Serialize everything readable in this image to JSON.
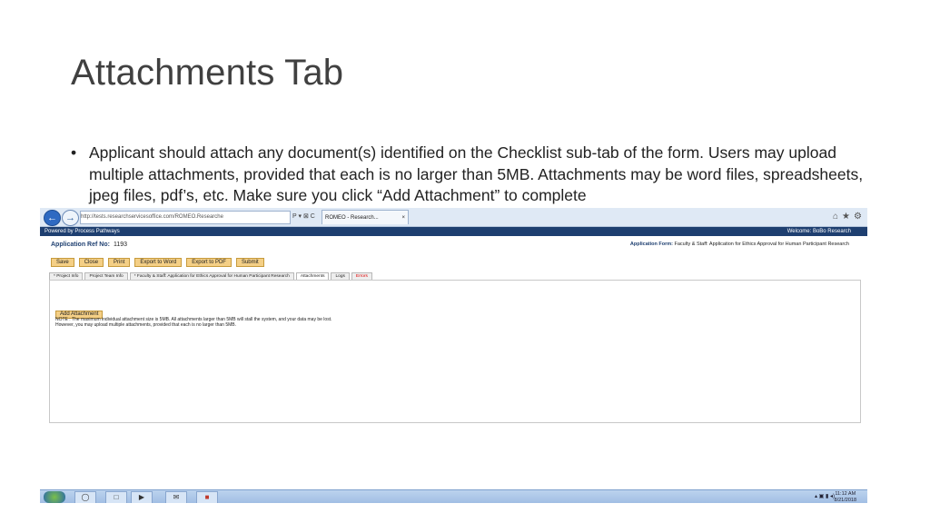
{
  "slide": {
    "title": "Attachments Tab",
    "bullet_marker": "•",
    "bullet_text": "Applicant should attach any document(s) identified on the Checklist sub-tab of the form. Users may upload multiple attachments, provided that each is no larger than 5MB. Attachments may be word files, spreadsheets, jpeg files, pdf’s, etc. Make sure you click “Add Attachment” to complete"
  },
  "browser": {
    "address": "http://tests.researchservicesoffice.com/ROMEO.Researche",
    "address_controls": "P ▾ ⊠ C",
    "tab_label": "ROMEO - Research...",
    "tab_close": "×",
    "icons": [
      "back-icon",
      "forward-icon",
      "home-icon",
      "star-icon",
      "gear-icon"
    ]
  },
  "app": {
    "powered_by": "Powered by Process Pathways",
    "welcome": "Welcome: BoBo Research",
    "ref_label": "Application Ref No:",
    "ref_number": "1193",
    "form_label": "Application Form:",
    "form_name": "Faculty & Staff: Application for Ethics Approval for Human Participant Research",
    "toolbar": [
      "Save",
      "Close",
      "Print",
      "Export to Word",
      "Export to PDF",
      "Submit"
    ],
    "tabs": [
      {
        "label": "* Project Info",
        "active": false
      },
      {
        "label": "Project Team Info",
        "active": false
      },
      {
        "label": "* Faculty & Staff: Application for Ethics Approval for Human Participant Research",
        "active": false
      },
      {
        "label": "Attachments",
        "active": true
      },
      {
        "label": "Logs",
        "active": false
      },
      {
        "label": "Errors",
        "active": false
      }
    ],
    "add_attachment": "Add Attachment",
    "note_line1": "NOTE : The maximum individual attachment size is 5MB. All attachments larger than 5MB will stall the system, and your data may be lost.",
    "note_line2": "However, you may upload multiple attachments, provided that each is no larger than 5MB."
  },
  "taskbar": {
    "clock_time": "11:12 AM",
    "clock_date": "8/21/2018",
    "tray_icons": "▴ ▣ ▮ ◂)"
  }
}
